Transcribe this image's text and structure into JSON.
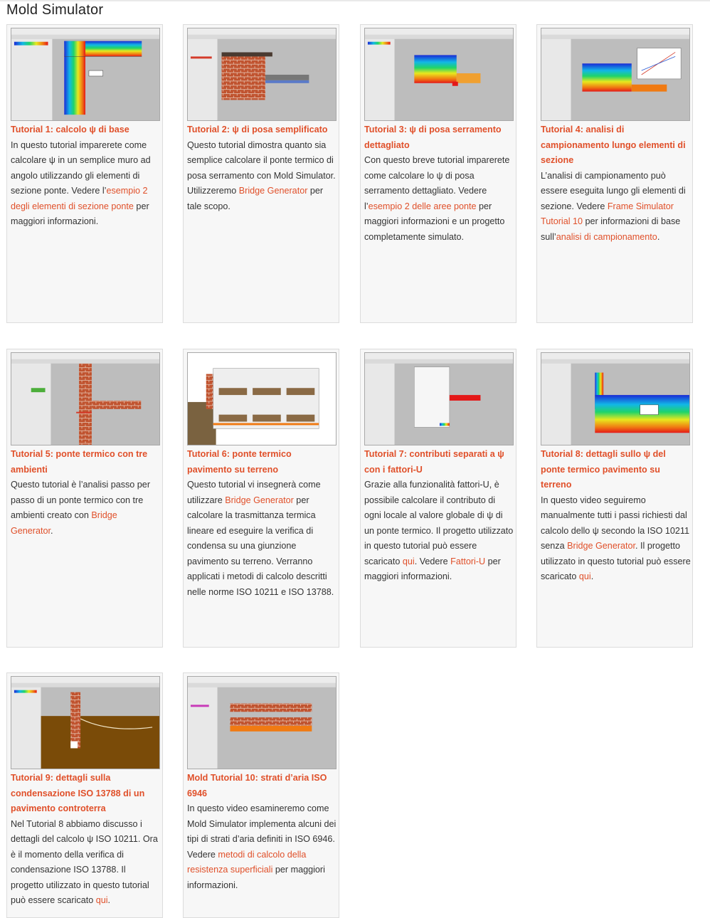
{
  "page": {
    "title": "Mold Simulator"
  },
  "colors": {
    "accent": "#e0502a",
    "card_bg": "#f7f7f7",
    "card_border": "#dcdcdc"
  },
  "cards": [
    {
      "title": "Tutorial 1: calcolo ψ di base",
      "d1": "In questo tutorial imparerete come calcolare ψ in un semplice muro ad angolo utilizzando gli elementi di sezione ponte. Vedere l’",
      "l1": "esempio 2 degli elementi di sezione ponte",
      "d2": " per maggiori informazioni."
    },
    {
      "title": "Tutorial 2: ψ di posa semplificato",
      "d1": "Questo tutorial dimostra quanto sia semplice calcolare il ponte termico di posa serramento con Mold Simulator. Utilizzeremo ",
      "l1": "Bridge Generator",
      "d2": " per tale scopo."
    },
    {
      "title": "Tutorial 3: ψ di posa serramento dettagliato",
      "d1": "Con questo breve tutorial imparerete come calcolare lo ψ di posa serramento dettagliato. Vedere l’",
      "l1": "esempio 2 delle aree ponte",
      "d2": " per maggiori informazioni e un progetto completamente simulato."
    },
    {
      "title": "Tutorial 4: analisi di campionamento lungo elementi di sezione",
      "d1": "L’analisi di campionamento può essere eseguita lungo gli elementi di sezione. Vedere ",
      "l1": "Frame Simulator Tutorial 10",
      "d2": " per informazioni di base sull’",
      "l2": "analisi di campionamento",
      "d3": "."
    },
    {
      "title": "Tutorial 5: ponte termico con tre ambienti",
      "d1": "Questo tutorial è l’analisi passo per passo di un ponte termico con tre ambienti creato con ",
      "l1": "Bridge Generator",
      "d2": "."
    },
    {
      "title": "Tutorial 6: ponte termico pavimento su terreno",
      "d1": "Questo tutorial vi insegnerà come utilizzare ",
      "l1": "Bridge Generator",
      "d2": " per calcolare la trasmittanza termica lineare ed eseguire la verifica di condensa su una giunzione pavimento su terreno. Verranno applicati i metodi di calcolo descritti nelle norme ISO 10211 e ISO 13788."
    },
    {
      "title": "Tutorial 7: contributi separati a ψ con i fattori-U",
      "d1": "Grazie alla funzionalità fattori-U, è possibile calcolare il contributo di ogni locale al valore globale di ψ di un ponte termico. Il progetto utilizzato in questo tutorial può essere scaricato ",
      "l1": "qui",
      "d2": ". Vedere ",
      "l2": "Fattori-U",
      "d3": " per maggiori informazioni."
    },
    {
      "title": "Tutorial 8: dettagli sullo ψ del ponte termico pavimento su terreno",
      "d1": "In questo video seguiremo manualmente tutti i passi richiesti dal calcolo dello ψ secondo la ISO 10211 senza ",
      "l1": "Bridge Generator",
      "d2": ". Il progetto utilizzato in questo tutorial può essere scaricato ",
      "l2": "qui",
      "d3": "."
    },
    {
      "title": "Tutorial 9: dettagli sulla condensazione ISO 13788 di un pavimento controterra",
      "d1": "Nel Tutorial 8 abbiamo discusso i dettagli del calcolo ψ ISO 10211. Ora è il momento della verifica di condensazione ISO 13788. Il progetto utilizzato in questo tutorial può essere scaricato ",
      "l1": "qui",
      "d2": "."
    },
    {
      "title": "Mold Tutorial 10: strati d’aria ISO 6946",
      "d1": "In questo video esamineremo come Mold Simulator implementa alcuni dei tipi di strati d’aria definiti in ISO 6946. Vedere ",
      "l1": "metodi di calcolo della resistenza superficiali",
      "d2": " per maggiori informazioni."
    }
  ]
}
